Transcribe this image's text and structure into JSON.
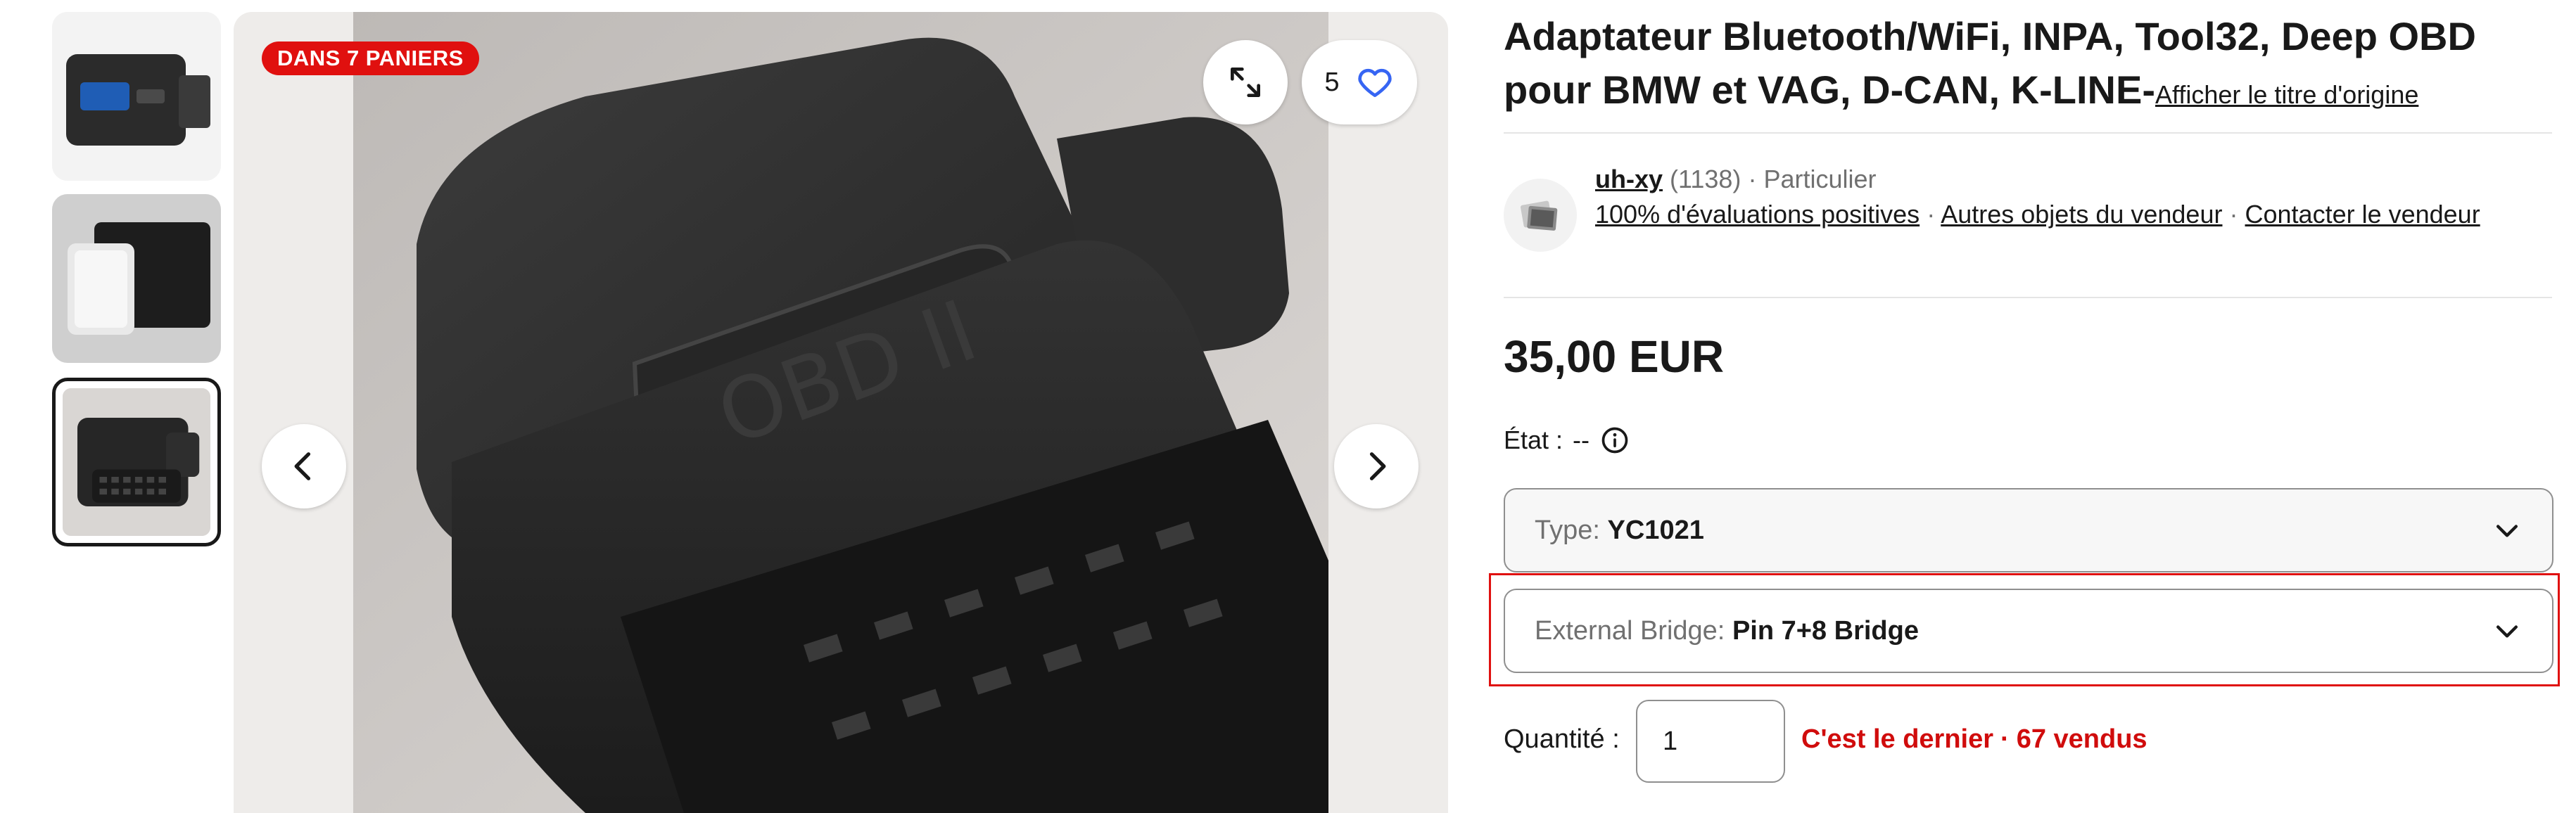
{
  "gallery": {
    "badge": "DANS 7 PANIERS",
    "watch_count": "5",
    "photo_text": "OBD II"
  },
  "listing": {
    "title": "Adaptateur Bluetooth/WiFi, INPA, Tool32, Deep OBD pour BMW et VAG, D-CAN, K-LINE-",
    "original_title_link": "Afficher le titre d'origine",
    "price": "35,00 EUR"
  },
  "seller": {
    "name": "uh-xy",
    "feedback_count": "(1138)",
    "type": "Particulier",
    "positive_feedback": "100% d'évaluations positives",
    "other_items": "Autres objets du vendeur",
    "contact": "Contacter le vendeur",
    "separator": "·"
  },
  "condition": {
    "label": "État :",
    "value": "--"
  },
  "variations": [
    {
      "label": "Type:",
      "value": "YC1021"
    },
    {
      "label": "External Bridge:",
      "value": "Pin 7+8 Bridge"
    }
  ],
  "quantity": {
    "label": "Quantité :",
    "value": "1",
    "last_item": "C'est le dernier",
    "sold": "67 vendus"
  },
  "colors": {
    "accent_red": "#e0100f",
    "link_blue": "#3665f3",
    "text": "#191919"
  }
}
